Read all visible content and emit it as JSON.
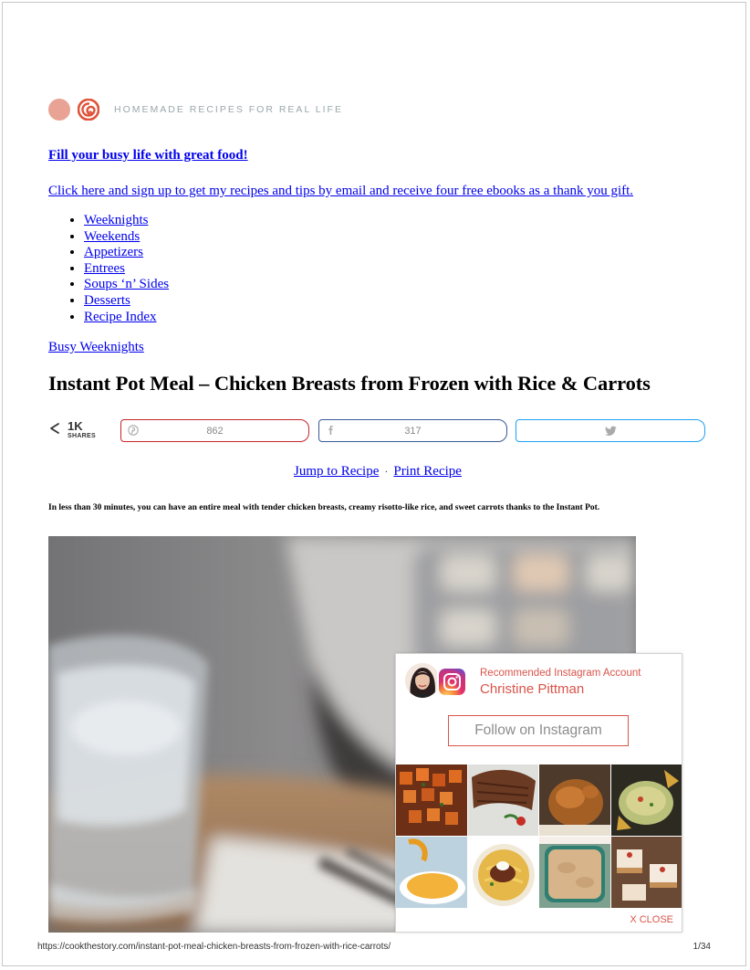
{
  "header": {
    "tagline": "HOMEMADE RECIPES FOR REAL LIFE"
  },
  "promo": {
    "title": "Fill your busy life with great food!",
    "subtitle": "Click here and sign up to get my recipes and tips by email and receive four free ebooks as a thank you gift."
  },
  "nav": {
    "items": [
      {
        "label": "Weeknights"
      },
      {
        "label": "Weekends"
      },
      {
        "label": "Appetizers"
      },
      {
        "label": "Entrees"
      },
      {
        "label": "Soups ‘n’ Sides"
      },
      {
        "label": "Desserts"
      },
      {
        "label": "Recipe Index"
      }
    ]
  },
  "post": {
    "category": "Busy Weeknights",
    "title": "Instant Pot Meal – Chicken Breasts from Frozen with Rice & Carrots",
    "intro": "In less than 30 minutes, you can have an entire meal with tender chicken breasts, creamy risotto-like rice, and sweet carrots thanks to the Instant Pot."
  },
  "share": {
    "total": "1K",
    "total_label": "SHARES",
    "pinterest_count": "862",
    "facebook_count": "317",
    "twitter_count": "",
    "colors": {
      "pinterest": "#c8232c",
      "facebook": "#3b5998",
      "twitter": "#1da1f2"
    }
  },
  "recipe_links": {
    "jump": "Jump to Recipe",
    "separator": "·",
    "print": "Print Recipe"
  },
  "instagram_widget": {
    "recommended_label": "Recommended Instagram Account",
    "account_name": "Christine Pittman",
    "follow_label": "Follow on Instagram",
    "close_label": "X CLOSE",
    "accent_color": "#d9544b"
  },
  "footer": {
    "url": "https://cookthestory.com/instant-pot-meal-chicken-breasts-from-frozen-with-rice-carrots/",
    "page": "1/34"
  }
}
